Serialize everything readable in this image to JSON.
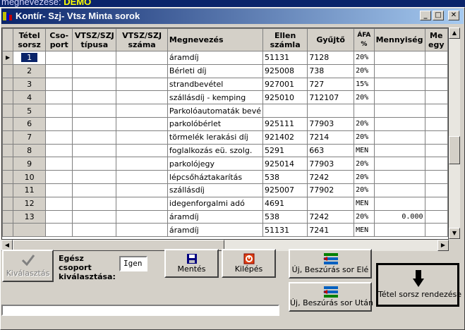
{
  "background": {
    "label": "megnevezése:",
    "value": "DEMO"
  },
  "window": {
    "title": "Kontír- Szj- Vtsz Minta sorok"
  },
  "grid": {
    "columns": [
      "Tétel sorsz",
      "Cso-port",
      "VTSZ/SZJ típusa",
      "VTSZ/SZJ száma",
      "Megnevezés",
      "Ellen számla",
      "Gyűjtő",
      "ÁFA %",
      "Mennyiség",
      "Me egy"
    ],
    "rows": [
      {
        "no": "1",
        "name": "áramdíj",
        "acct": "51131",
        "coll": "7128",
        "vat": "20%",
        "qty": ""
      },
      {
        "no": "2",
        "name": "Bérleti díj",
        "acct": "925008",
        "coll": "738",
        "vat": "20%",
        "qty": ""
      },
      {
        "no": "3",
        "name": "strandbevétel",
        "acct": "927001",
        "coll": "727",
        "vat": "15%",
        "qty": ""
      },
      {
        "no": "4",
        "name": "szállásdíj - kemping",
        "acct": "925010",
        "coll": "712107",
        "vat": "20%",
        "qty": ""
      },
      {
        "no": "5",
        "name": "Parkolóautomaták bevé",
        "acct": "",
        "coll": "",
        "vat": "",
        "qty": ""
      },
      {
        "no": "6",
        "name": "parkolóbérlet",
        "acct": "925111",
        "coll": "77903",
        "vat": "20%",
        "qty": ""
      },
      {
        "no": "7",
        "name": "törmelék lerakási díj",
        "acct": "921402",
        "coll": "7214",
        "vat": "20%",
        "qty": ""
      },
      {
        "no": "8",
        "name": "foglalkozás eü. szolg.",
        "acct": "5291",
        "coll": "663",
        "vat": "MEN",
        "qty": ""
      },
      {
        "no": "9",
        "name": "parkolójegy",
        "acct": "925014",
        "coll": "77903",
        "vat": "20%",
        "qty": ""
      },
      {
        "no": "10",
        "name": "lépcsőháztakarítás",
        "acct": "538",
        "coll": "7242",
        "vat": "20%",
        "qty": ""
      },
      {
        "no": "11",
        "name": "szállásdíj",
        "acct": "925007",
        "coll": "77902",
        "vat": "20%",
        "qty": ""
      },
      {
        "no": "12",
        "name": "idegenforgalmi adó",
        "acct": "4691",
        "coll": "",
        "vat": "MEN",
        "qty": ""
      },
      {
        "no": "13",
        "name": "áramdíj",
        "acct": "538",
        "coll": "7242",
        "vat": "20%",
        "qty": "0.000"
      },
      {
        "no": "",
        "name": "áramdíj",
        "acct": "51131",
        "coll": "7241",
        "vat": "MEN",
        "qty": ""
      }
    ]
  },
  "controls": {
    "select_label": "Kiválasztás",
    "group_select_label": "Egész csoport kiválasztása:",
    "group_select_value": "Igen",
    "save_label": "Mentés",
    "exit_label": "Kilépés",
    "insert_before_label": "Új, Beszúrás sor Elé",
    "insert_after_label": "Új, Beszúrás sor Után",
    "sort_label": "Tétel sorsz rendezése",
    "status_text": ""
  },
  "colors": {
    "selection": "#0a246a",
    "title_start": "#0a246a",
    "title_end": "#a6caf0"
  }
}
